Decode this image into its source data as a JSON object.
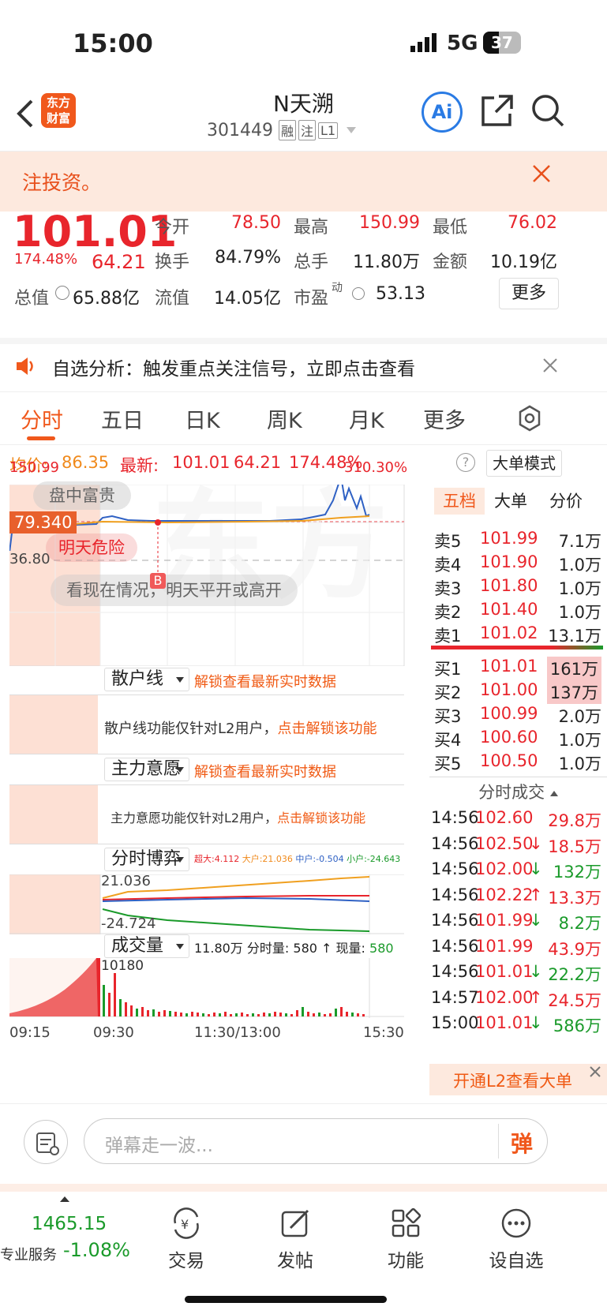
{
  "status": {
    "time": "15:00",
    "network": "5G",
    "battery": "37"
  },
  "nav": {
    "logo_line1": "东方",
    "logo_line2": "财富",
    "title": "N天溯",
    "code": "301449",
    "badges": [
      "融",
      "注",
      "L1"
    ],
    "ai": "Ai"
  },
  "notice": {
    "text": "注投资。"
  },
  "quote": {
    "price": "101.01",
    "pct": "174.48%",
    "change": "64.21",
    "open_label": "今开",
    "open": "78.50",
    "high_label": "最高",
    "high": "150.99",
    "low_label": "最低",
    "low": "76.02",
    "turnover_label": "换手",
    "turnover": "84.79%",
    "vol_label": "总手",
    "vol": "11.80万",
    "amt_label": "金额",
    "amt": "10.19亿",
    "cap_label": "总值",
    "cap": "65.88亿",
    "float_label": "流值",
    "float": "14.05亿",
    "pe_label": "市盈",
    "pe_sup": "动",
    "pe": "53.13",
    "more": "更多"
  },
  "promo": {
    "text": "自选分析：触发重点关注信号，立即点击查看"
  },
  "tabs": [
    "分时",
    "五日",
    "日K",
    "周K",
    "月K",
    "更多"
  ],
  "info": {
    "avg_label": "均价:",
    "avg": "86.35",
    "latest_label": "最新:",
    "latest": "101.01",
    "change": "64.21",
    "pct": "174.48%",
    "mode": "大单模式"
  },
  "chart": {
    "ymax": "150.99",
    "ymax_pct": "310.30%",
    "cur_tag": "79.340",
    "ref": "36.80",
    "tag1": "盘中富贵",
    "tag2": "明天危险",
    "tag3": "看现在情况，明天平开或高开",
    "marker": "B",
    "watermark": "东方财富",
    "panel1": {
      "label": "散户线",
      "unlock": "解锁查看最新实时数据",
      "msg": "散户线功能仅针对L2用户，",
      "link": "点击解锁该功能"
    },
    "panel2": {
      "label": "主力意愿",
      "unlock": "解锁查看最新实时数据",
      "msg": "主力意愿功能仅针对L2用户，",
      "link": "点击解锁该功能"
    },
    "panel3": {
      "label": "分时博弈",
      "big": "超大:4.112",
      "large": "大户:21.036",
      "mid": "中户:-0.504",
      "small": "小户:-24.643",
      "top": "21.036",
      "bottom": "-24.724"
    },
    "panel4": {
      "label": "成交量",
      "vol": "11.80万",
      "fs_label": "分时量:",
      "fs": "580",
      "arrow": "↑",
      "now_label": "现量:",
      "now": "580",
      "max": "10180"
    },
    "times": [
      "09:15",
      "09:30",
      "11:30/13:00",
      "15:30"
    ]
  },
  "side": {
    "tabs": [
      "五档",
      "大单",
      "分价"
    ],
    "sell": [
      {
        "l": "卖5",
        "p": "101.99",
        "v": "7.1万"
      },
      {
        "l": "卖4",
        "p": "101.90",
        "v": "1.0万"
      },
      {
        "l": "卖3",
        "p": "101.80",
        "v": "1.0万"
      },
      {
        "l": "卖2",
        "p": "101.40",
        "v": "1.0万"
      },
      {
        "l": "卖1",
        "p": "101.02",
        "v": "13.1万"
      }
    ],
    "buy": [
      {
        "l": "买1",
        "p": "101.01",
        "v": "161万"
      },
      {
        "l": "买2",
        "p": "101.00",
        "v": "137万"
      },
      {
        "l": "买3",
        "p": "100.99",
        "v": "2.0万"
      },
      {
        "l": "买4",
        "p": "100.60",
        "v": "1.0万"
      },
      {
        "l": "买5",
        "p": "100.50",
        "v": "1.0万"
      }
    ],
    "trades_title": "分时成交",
    "trades": [
      {
        "t": "14:56",
        "p": "102.60",
        "a": "",
        "v": "29.8万",
        "c": "red"
      },
      {
        "t": "14:56",
        "p": "102.50",
        "a": "↓",
        "v": "18.5万",
        "c": "red"
      },
      {
        "t": "14:56",
        "p": "102.00",
        "a": "↓",
        "v": "132万",
        "c": "green"
      },
      {
        "t": "14:56",
        "p": "102.22",
        "a": "↑",
        "v": "13.3万",
        "c": "red"
      },
      {
        "t": "14:56",
        "p": "101.99",
        "a": "↓",
        "v": "8.2万",
        "c": "green"
      },
      {
        "t": "14:56",
        "p": "101.99",
        "a": "",
        "v": "43.9万",
        "c": "red"
      },
      {
        "t": "14:56",
        "p": "101.01",
        "a": "↓",
        "v": "22.2万",
        "c": "green"
      },
      {
        "t": "14:57",
        "p": "102.00",
        "a": "↑",
        "v": "24.5万",
        "c": "red"
      },
      {
        "t": "15:00",
        "p": "101.01",
        "a": "↓",
        "v": "586万",
        "c": "green"
      }
    ],
    "l2": "开通L2查看大单"
  },
  "bottom": {
    "placeholder": "弹幕走一波...",
    "dan": "弹"
  },
  "tabbar": {
    "index": "1465.15",
    "index_label": "专业服务",
    "index_pct": "-1.08%",
    "items": [
      "交易",
      "发帖",
      "功能",
      "设自选"
    ]
  }
}
